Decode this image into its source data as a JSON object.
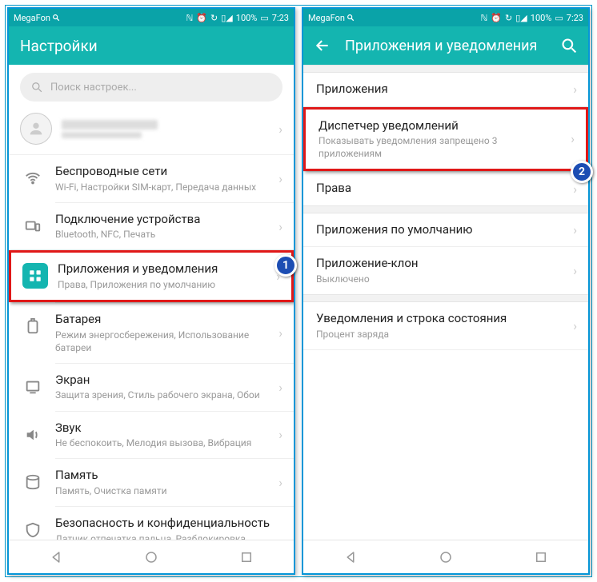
{
  "status": {
    "carrier": "MegaFon",
    "battery": "100%",
    "time": "7:23"
  },
  "left": {
    "title": "Настройки",
    "search_placeholder": "Поиск настроек...",
    "items": [
      {
        "t": "Беспроводные сети",
        "s": "Wi-Fi, Настройки SIM-карт, Передача данных"
      },
      {
        "t": "Подключение устройства",
        "s": "Bluetooth, NFC, Печать"
      },
      {
        "t": "Приложения и уведомления",
        "s": "Права, Приложения по умолчанию"
      },
      {
        "t": "Батарея",
        "s": "Режим энергосбережения, Использование батареи"
      },
      {
        "t": "Экран",
        "s": "Защита зрения, Стиль рабочего экрана, Обои"
      },
      {
        "t": "Звук",
        "s": "Не беспокоить, Мелодия вызова, Вибрация"
      },
      {
        "t": "Память",
        "s": "Память, Очистка памяти"
      },
      {
        "t": "Безопасность и конфиденциальность",
        "s": "Датчик отпечатка пальца, Разблокировка распознаванием лица, Пароль экрана"
      }
    ]
  },
  "right": {
    "title": "Приложения и уведомления",
    "items": [
      {
        "t": "Приложения",
        "s": ""
      },
      {
        "t": "Диспетчер уведомлений",
        "s": "Показывать уведомления запрещено 3 приложениям"
      },
      {
        "t": "Права",
        "s": ""
      },
      {
        "t": "Приложения по умолчанию",
        "s": ""
      },
      {
        "t": "Приложение-клон",
        "s": "Выключено"
      },
      {
        "t": "Уведомления и строка состояния",
        "s": "Процент заряда"
      }
    ]
  },
  "badges": {
    "one": "1",
    "two": "2"
  }
}
